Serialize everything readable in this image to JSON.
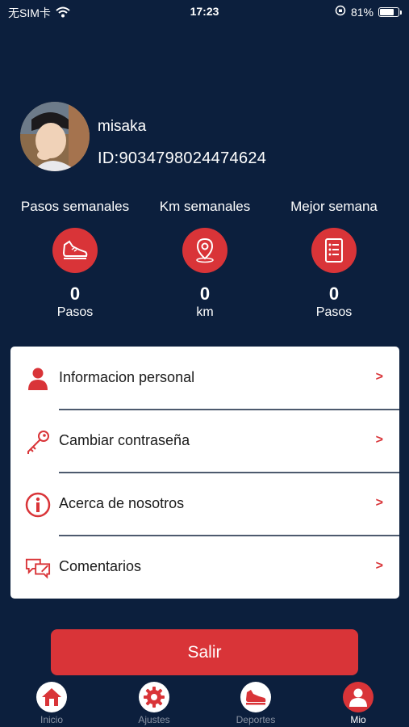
{
  "status_bar": {
    "carrier": "无SIM卡",
    "time": "17:23",
    "battery_text": "81%",
    "battery_level": 0.81
  },
  "profile": {
    "username": "misaka",
    "id": "ID:9034798024474624"
  },
  "stats": [
    {
      "label": "Pasos semanales",
      "value": "0",
      "unit": "Pasos",
      "icon": "shoe-icon"
    },
    {
      "label": "Km semanales",
      "value": "0",
      "unit": "km",
      "icon": "location-pin-icon"
    },
    {
      "label": "Mejor semana",
      "value": "0",
      "unit": "Pasos",
      "icon": "checklist-icon"
    }
  ],
  "menu": [
    {
      "label": "Informacion personal",
      "arrow": ">",
      "icon": "person-icon"
    },
    {
      "label": "Cambiar contraseña",
      "arrow": ">",
      "icon": "key-icon"
    },
    {
      "label": "Acerca de nosotros",
      "arrow": ">",
      "icon": "info-icon"
    },
    {
      "label": "Comentarios",
      "arrow": ">",
      "icon": "comment-icon"
    }
  ],
  "logout_label": "Salir",
  "tabs": [
    {
      "label": "Inicio",
      "icon": "home-icon",
      "active": false
    },
    {
      "label": "Ajustes",
      "icon": "gear-icon",
      "active": false
    },
    {
      "label": "Deportes",
      "icon": "shoe-icon",
      "active": false
    },
    {
      "label": "Mio",
      "icon": "user-icon",
      "active": true
    }
  ],
  "colors": {
    "background": "#0c1f3d",
    "accent": "#d93438",
    "card": "#ffffff"
  }
}
